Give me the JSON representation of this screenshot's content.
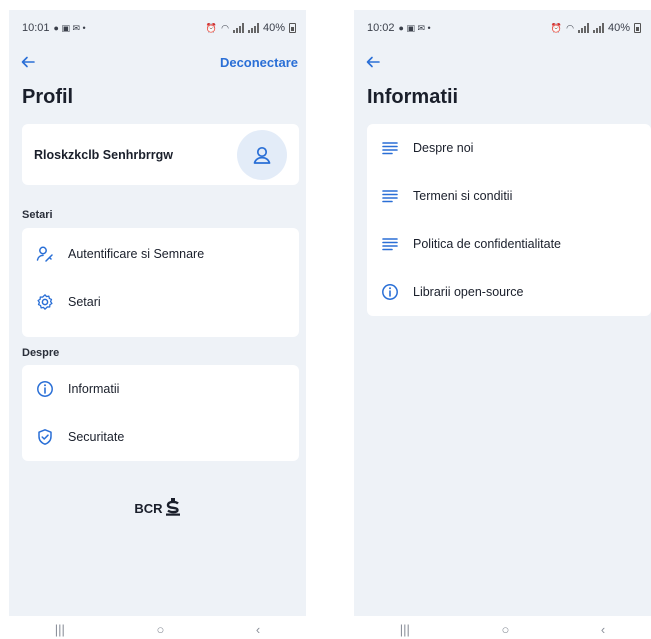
{
  "left_screen": {
    "status": {
      "time": "10:01",
      "battery": "40%"
    },
    "logout_label": "Deconectare",
    "title": "Profil",
    "profile": {
      "name": "Rloskzkclb Senhrbrrgw"
    },
    "sections": {
      "setari_label": "Setari",
      "setari_items": [
        {
          "label": "Autentificare si Semnare",
          "icon": "user-key-icon"
        },
        {
          "label": "Setari",
          "icon": "gear-icon"
        }
      ],
      "despre_label": "Despre",
      "despre_items": [
        {
          "label": "Informatii",
          "icon": "info-icon"
        },
        {
          "label": "Securitate",
          "icon": "shield-icon"
        }
      ]
    },
    "logo_text": "BCR"
  },
  "right_screen": {
    "status": {
      "time": "10:02",
      "battery": "40%"
    },
    "title": "Informatii",
    "items": [
      {
        "label": "Despre noi",
        "icon": "lines-icon"
      },
      {
        "label": "Termeni si conditii",
        "icon": "lines-icon"
      },
      {
        "label": "Politica de confidentialitate",
        "icon": "lines-icon"
      },
      {
        "label": "Librarii open-source",
        "icon": "info-icon"
      }
    ]
  },
  "nav": {
    "recent": "|||",
    "home": "○",
    "back": "‹"
  },
  "colors": {
    "accent": "#2a6fd6",
    "background": "#eef2f7",
    "card": "#ffffff"
  }
}
